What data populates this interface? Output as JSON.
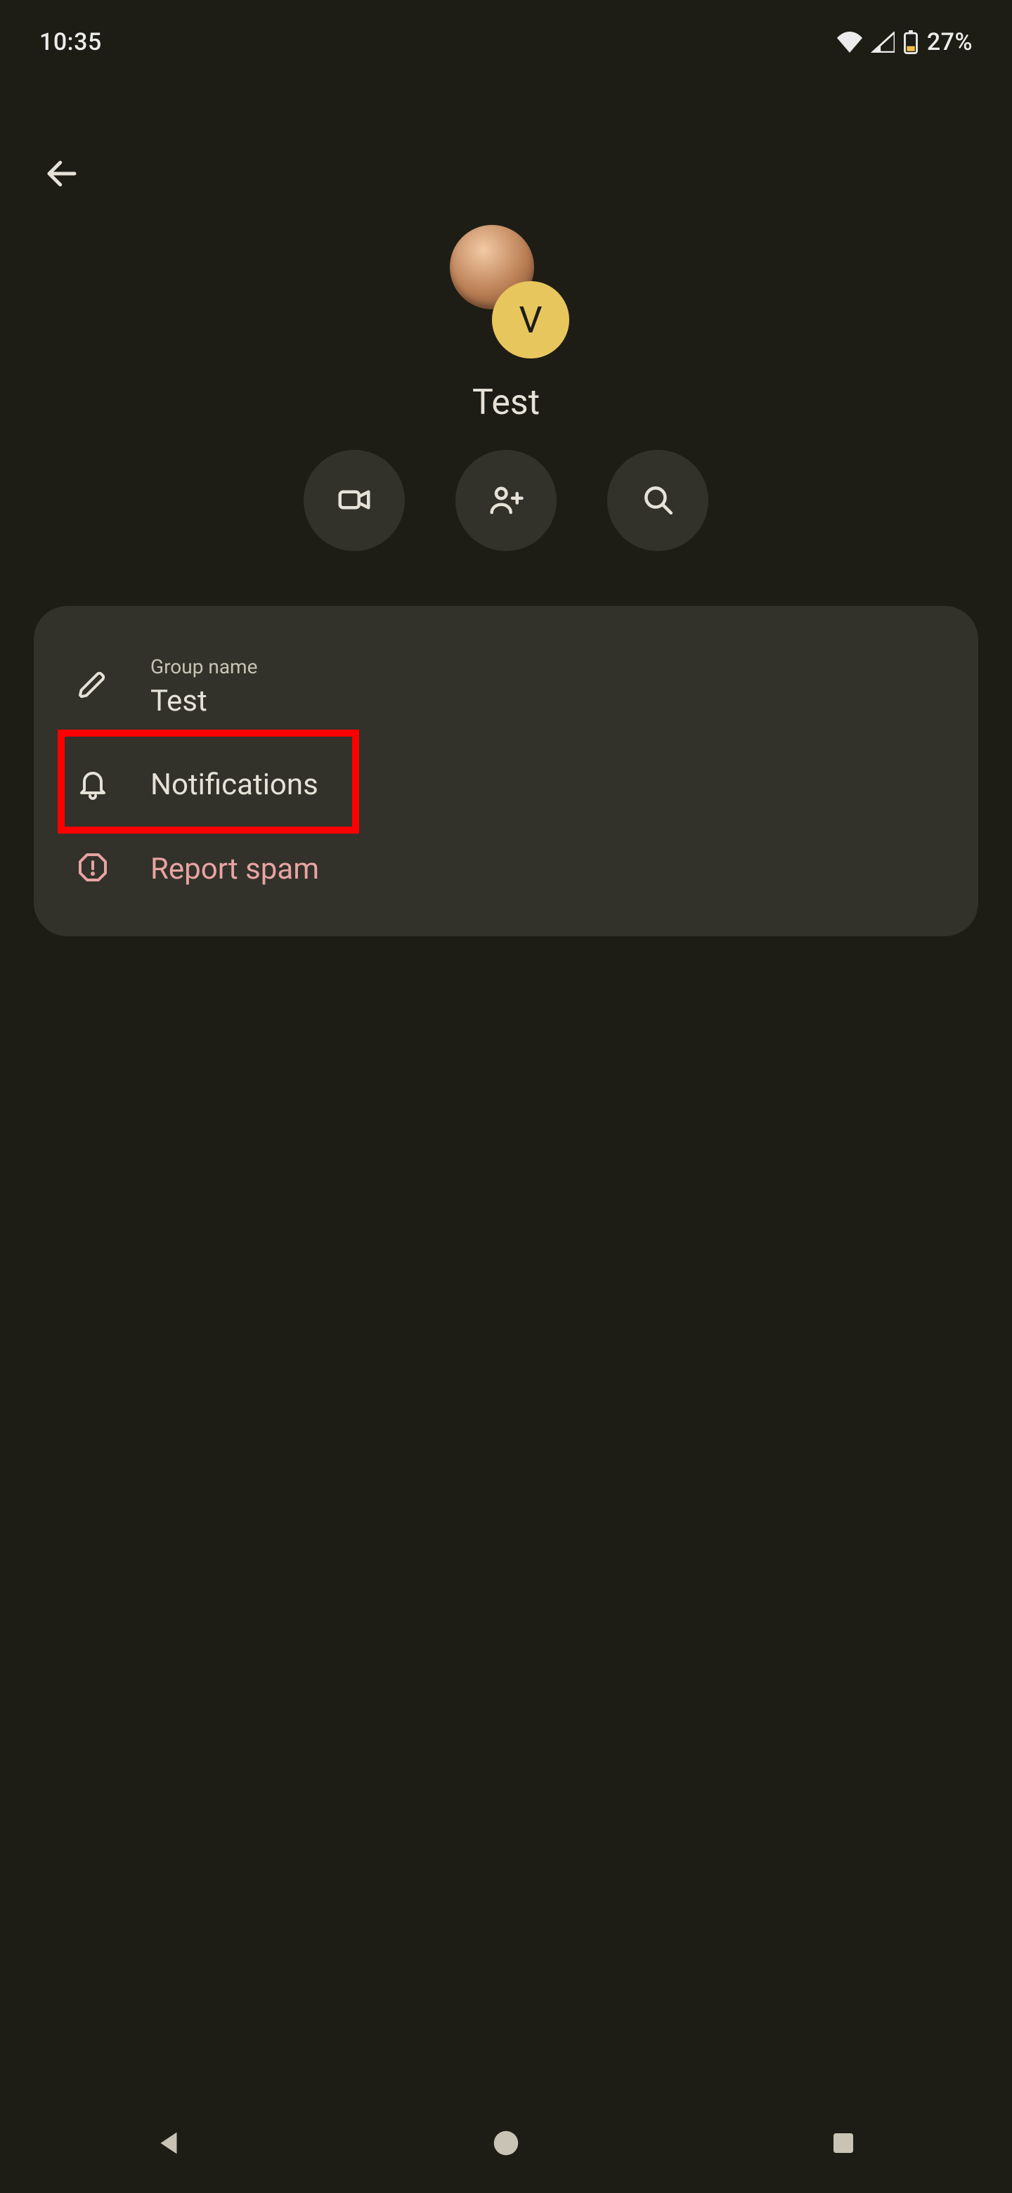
{
  "status": {
    "time": "10:35",
    "battery_percent": "27%"
  },
  "header": {
    "avatar_sub_initial": "V",
    "title": "Test"
  },
  "actions": {
    "video": "video-call",
    "add": "add-person",
    "search": "search"
  },
  "card": {
    "group_name": {
      "label": "Group name",
      "value": "Test"
    },
    "notifications_label": "Notifications",
    "report_spam_label": "Report spam"
  },
  "colors": {
    "bg": "#1d1d15",
    "surface": "#32322a",
    "on_surface": "#e6e2d7",
    "accent_avatar": "#e8c65e",
    "danger": "#e9a3a3",
    "highlight": "#ff0000"
  }
}
